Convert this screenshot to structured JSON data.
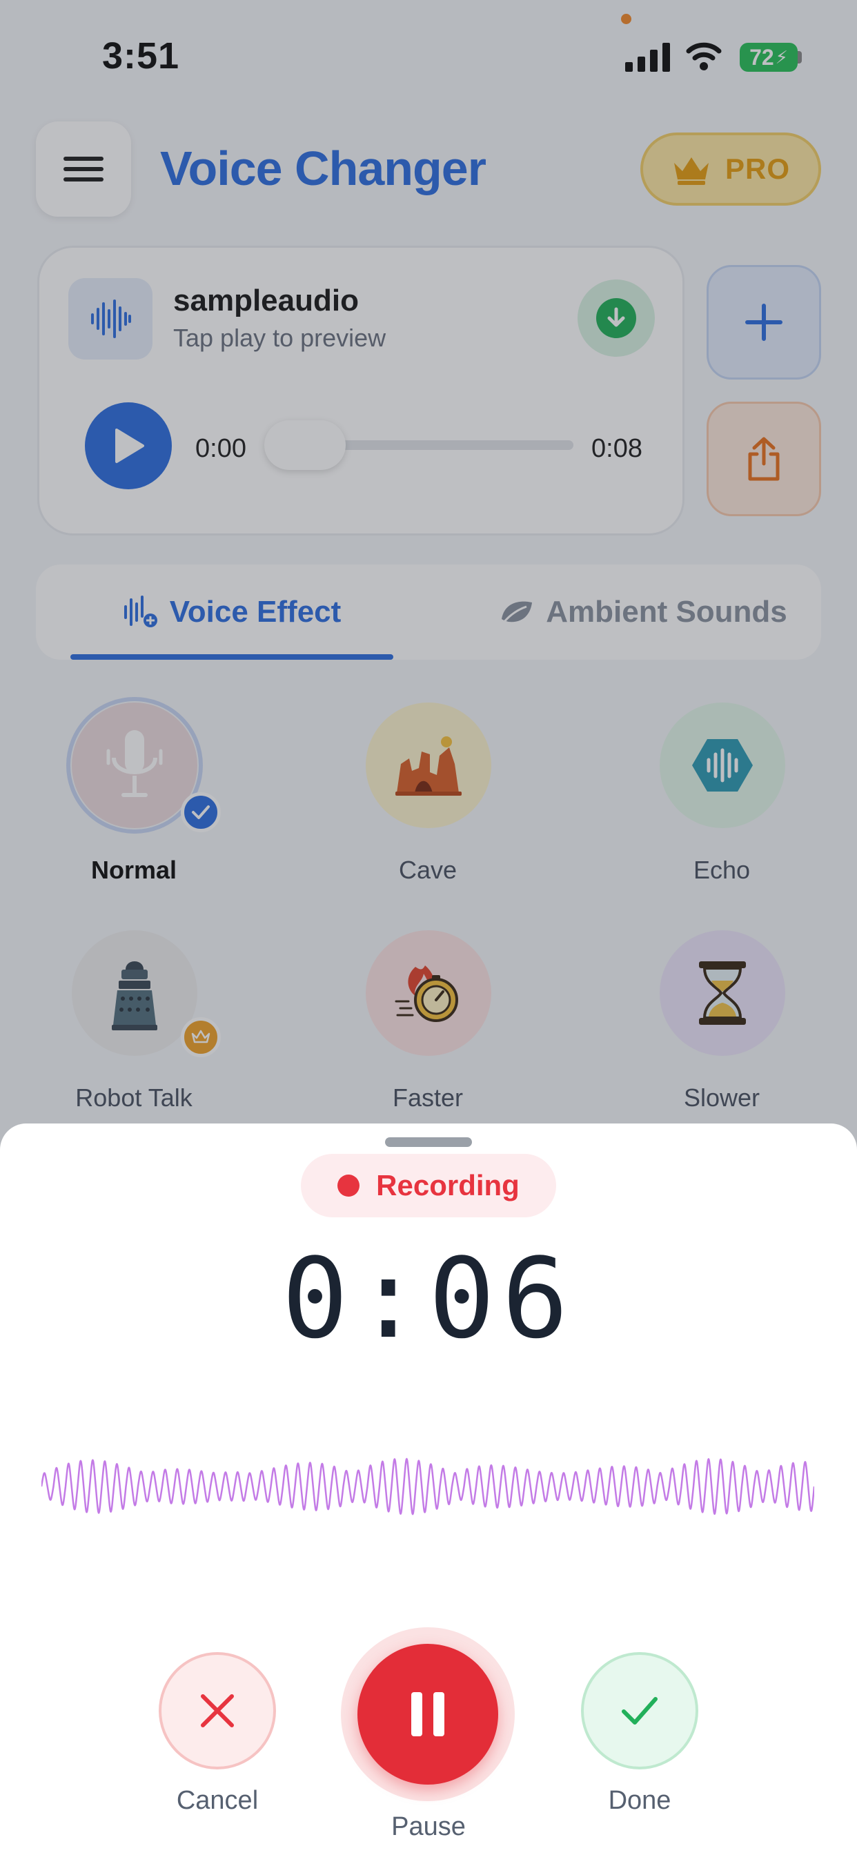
{
  "status_bar": {
    "time": "3:51",
    "battery": "72"
  },
  "header": {
    "title": "Voice Changer",
    "pro_label": "PRO"
  },
  "audio": {
    "file_name": "sampleaudio",
    "subtitle": "Tap play to preview",
    "current_time": "0:00",
    "total_time": "0:08",
    "progress": 0.0
  },
  "tabs": [
    {
      "label": "Voice Effect",
      "active": true
    },
    {
      "label": "Ambient Sounds",
      "active": false
    }
  ],
  "effects": [
    {
      "label": "Normal",
      "icon": "microphone-icon",
      "selected": true
    },
    {
      "label": "Cave",
      "icon": "cave-icon"
    },
    {
      "label": "Echo",
      "icon": "echo-icon"
    },
    {
      "label": "Robot Talk",
      "icon": "robot-icon",
      "pro": true
    },
    {
      "label": "Faster",
      "icon": "stopwatch-fast-icon"
    },
    {
      "label": "Slower",
      "icon": "hourglass-icon"
    }
  ],
  "recording": {
    "status": "Recording",
    "timer": "0:06",
    "cancel_label": "Cancel",
    "pause_label": "Pause",
    "done_label": "Done"
  },
  "colors": {
    "accent": "#2f6fe0",
    "record": "#e7343f",
    "done": "#22b05a",
    "pro": "#e59e12",
    "waveform": "#c37be6"
  }
}
